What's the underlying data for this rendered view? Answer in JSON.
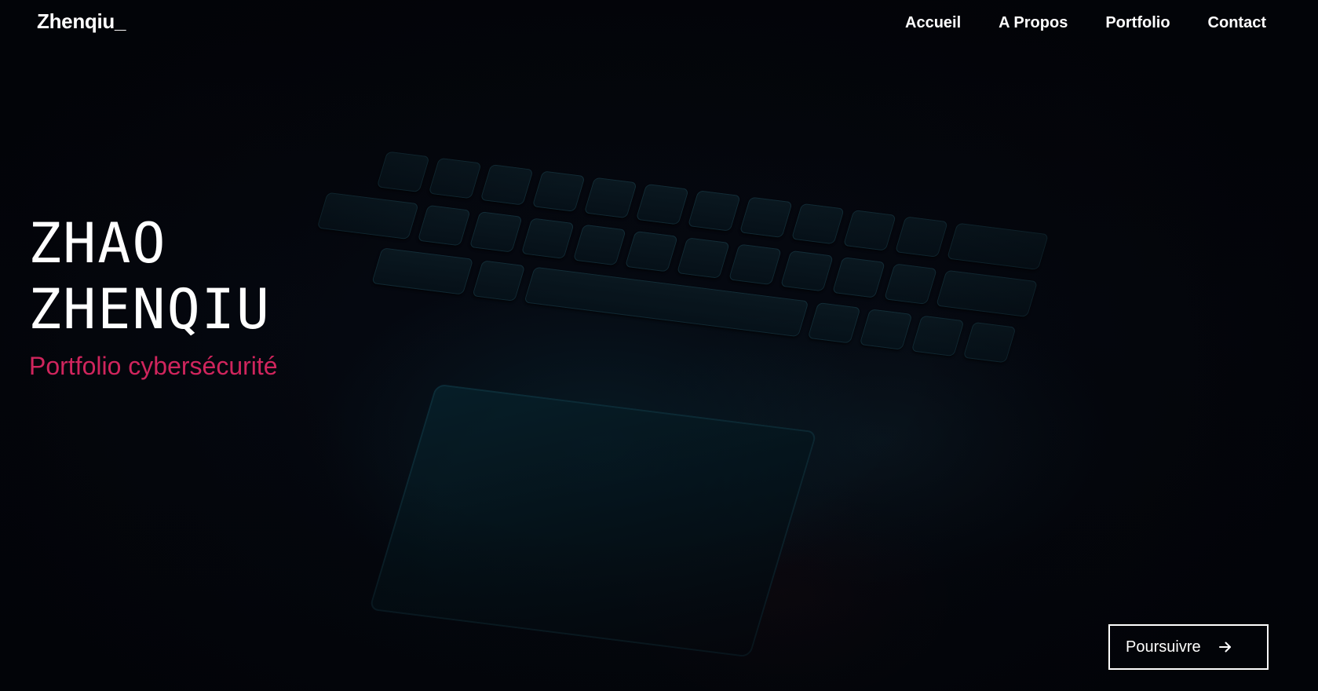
{
  "header": {
    "logo": "Zhenqiu_",
    "nav": [
      {
        "label": "Accueil"
      },
      {
        "label": "A Propos"
      },
      {
        "label": "Portfolio"
      },
      {
        "label": "Contact"
      }
    ]
  },
  "hero": {
    "title_line1": "ZHAO",
    "title_line2": "ZHENQIU",
    "subtitle": "Portfolio cybersécurité",
    "cta_label": "Poursuivre",
    "cta_icon": "arrow-right-icon"
  },
  "colors": {
    "background": "#05070c",
    "text": "#ffffff",
    "accent": "#d0255d"
  }
}
